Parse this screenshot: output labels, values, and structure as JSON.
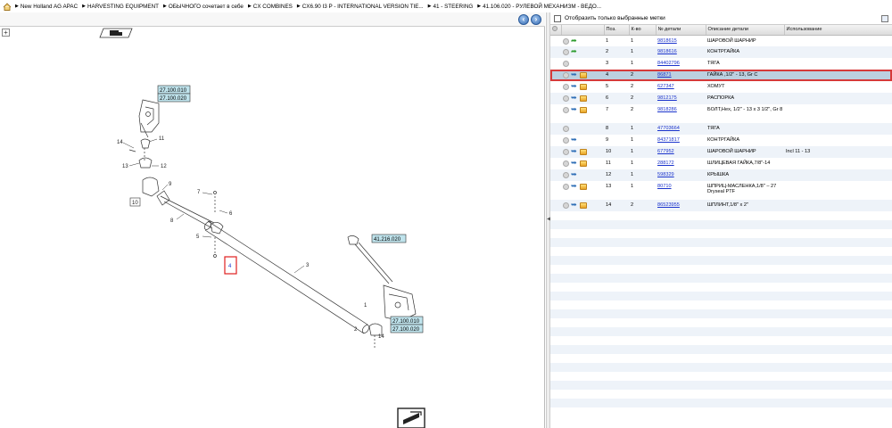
{
  "breadcrumb": {
    "items": [
      "New Holland AG APAC",
      "HARVESTING EQUIPMENT",
      "ОБЫЧНОГО сочетает в себе",
      "CX COMBINES",
      "CX6.90 I3 P - INTERNATIONAL VERSION TIE...",
      "41 - STEERING",
      "41.106.020 - РУЛЕВОЙ МЕХАНИЗМ - ВЕДО..."
    ]
  },
  "toolbar": {
    "zoom_in": "+",
    "back": "‹",
    "forward": "›"
  },
  "diagram": {
    "ref_top_1": "27.100.010",
    "ref_top_2": "27.100.020",
    "ref_right": "41.216.020",
    "ref_bottom_1": "27.100.010",
    "ref_bottom_2": "27.100.020",
    "callouts": [
      "14",
      "11",
      "13",
      "12",
      "9",
      "10",
      "8",
      "7",
      "6",
      "5",
      "3",
      "1",
      "2",
      "14"
    ],
    "highlight_label": "4"
  },
  "filter": {
    "label": "Отобразить только выбранные метки"
  },
  "table": {
    "headers": [
      "",
      "",
      "Поз.",
      "К-во",
      "№ детали",
      "Описание детали",
      "Использование"
    ],
    "rows": [
      {
        "pos": "1",
        "qty": "1",
        "part": "9818615",
        "desc": "ШАРОВОЙ ШАРНИР",
        "usage": "",
        "icons": [
          "circle",
          "fwd"
        ]
      },
      {
        "pos": "2",
        "qty": "1",
        "part": "9818616",
        "desc": "КОНТРГАЙКА",
        "usage": "",
        "icons": [
          "circle",
          "fwd"
        ]
      },
      {
        "pos": "3",
        "qty": "1",
        "part": "84402796",
        "desc": "ТЯГА",
        "usage": "",
        "icons": [
          "circle"
        ]
      },
      {
        "pos": "4",
        "qty": "2",
        "part": "86871",
        "desc": "ГАЙКА ,1/2\" - 13, Gr C",
        "usage": "",
        "icons": [
          "circle",
          "link",
          "box"
        ],
        "selected": true
      },
      {
        "pos": "5",
        "qty": "2",
        "part": "627347",
        "desc": "ХОМУТ",
        "usage": "",
        "icons": [
          "circle",
          "link",
          "box"
        ]
      },
      {
        "pos": "6",
        "qty": "2",
        "part": "9812175",
        "desc": "РАСПОРКА",
        "usage": "",
        "icons": [
          "circle",
          "link",
          "box"
        ]
      },
      {
        "pos": "7",
        "qty": "2",
        "part": "9818286",
        "desc": "БОЛТ,Hex, 1/2\" - 13 x 3 1/2\", Gr 8",
        "usage": "",
        "icons": [
          "circle",
          "link",
          "box"
        ],
        "tall": true
      },
      {
        "pos": "8",
        "qty": "1",
        "part": "47703664",
        "desc": "ТЯГА",
        "usage": "",
        "icons": [
          "circle"
        ]
      },
      {
        "pos": "9",
        "qty": "1",
        "part": "84371817",
        "desc": "КОНТРГАЙКА",
        "usage": "",
        "icons": [
          "circle",
          "link"
        ]
      },
      {
        "pos": "10",
        "qty": "1",
        "part": "677952",
        "desc": "ШАРОВОЙ ШАРНИР",
        "usage": "Incl 11 - 13",
        "icons": [
          "circle",
          "link",
          "box"
        ]
      },
      {
        "pos": "11",
        "qty": "1",
        "part": "288172",
        "desc": "ШЛИЦЕВАЯ ГАЙКА,7/8\"-14",
        "usage": "",
        "icons": [
          "circle",
          "link",
          "box"
        ]
      },
      {
        "pos": "12",
        "qty": "1",
        "part": "598329",
        "desc": "КРЫШКА",
        "usage": "",
        "icons": [
          "circle",
          "link"
        ]
      },
      {
        "pos": "13",
        "qty": "1",
        "part": "80710",
        "desc": "ШПРИЦ-МАСЛЕНКА,1/8\" – 27 Dryseal PTF",
        "usage": "",
        "icons": [
          "circle",
          "link",
          "box"
        ],
        "tall": true
      },
      {
        "pos": "14",
        "qty": "2",
        "part": "86523955",
        "desc": "ШПЛИНТ,1/8\" x 2\"",
        "usage": "",
        "icons": [
          "circle",
          "link",
          "box"
        ]
      }
    ]
  }
}
